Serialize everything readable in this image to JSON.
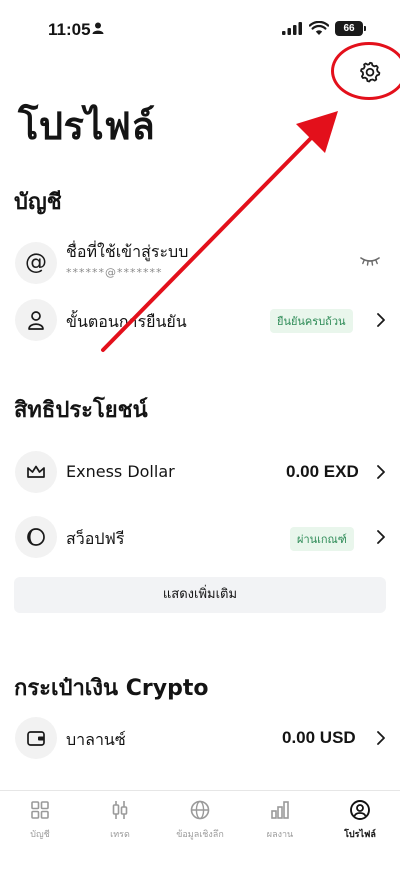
{
  "status_bar": {
    "time": "11:05",
    "battery": "66"
  },
  "header": {
    "title": "โปรไฟล์"
  },
  "account": {
    "title": "บัญชี",
    "username_label": "ชื่อที่ใช้เข้าสู่ระบบ",
    "username_value": "******@*******",
    "verification_label": "ขั้นตอนการยืนยัน",
    "verification_badge": "ยืนยันครบถ้วน"
  },
  "benefits": {
    "title": "สิทธิประโยชน์",
    "exness_label": "Exness Dollar",
    "exness_value": "0.00 EXD",
    "swap_label": "สว็อปฟรี",
    "swap_badge": "ผ่านเกณฑ์",
    "show_more": "แสดงเพิ่มเติม"
  },
  "crypto": {
    "title": "กระเป๋าเงิน Crypto",
    "balance_label": "บาลานซ์",
    "balance_value": "0.00 USD"
  },
  "bottom_nav": {
    "items": [
      {
        "label": "บัญชี",
        "icon": "accounts-grid-icon"
      },
      {
        "label": "เทรด",
        "icon": "trade-candles-icon"
      },
      {
        "label": "ข้อมูลเชิงลึก",
        "icon": "globe-icon"
      },
      {
        "label": "ผลงาน",
        "icon": "bar-chart-icon"
      },
      {
        "label": "โปรไฟล์",
        "icon": "profile-icon",
        "active": true
      }
    ]
  },
  "colors": {
    "accent_annotation": "#e3101b",
    "badge_green": "#2e8b57",
    "badge_bg": "#e9f6ec"
  }
}
